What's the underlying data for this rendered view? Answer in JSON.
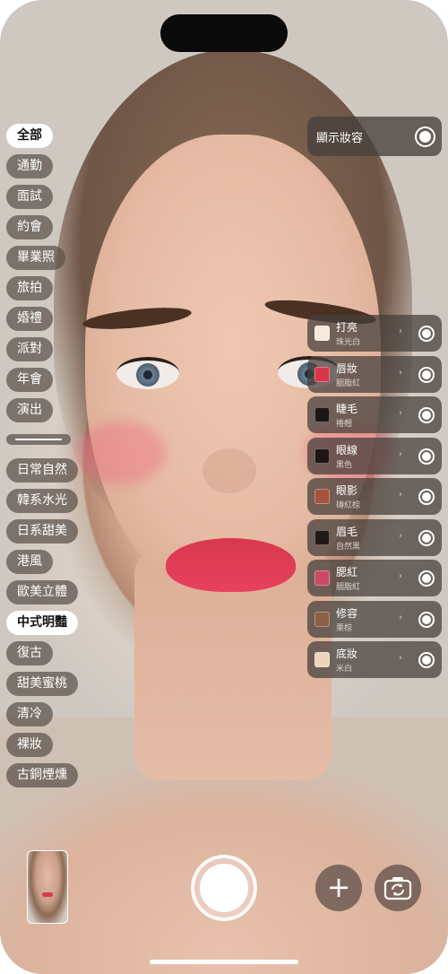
{
  "categories": {
    "occasions": [
      "全部",
      "通勤",
      "面試",
      "約會",
      "畢業照",
      "旅拍",
      "婚禮",
      "派對",
      "年會",
      "演出"
    ],
    "styles": [
      "日常自然",
      "韓系水光",
      "日系甜美",
      "港風",
      "歐美立體",
      "中式明豔",
      "復古",
      "甜美蜜桃",
      "清冷",
      "裸妝",
      "古銅煙燻"
    ],
    "active_occasion": "全部",
    "active_style": "中式明豔"
  },
  "show_makeup": {
    "label": "顯示妝容",
    "enabled": true
  },
  "makeup_items": [
    {
      "title": "打亮",
      "subtitle": "珠光白",
      "color": "#f6eadc",
      "enabled": true
    },
    {
      "title": "唇妝",
      "subtitle": "胭脂紅",
      "color": "#d8344a",
      "enabled": true
    },
    {
      "title": "睫毛",
      "subtitle": "捲翹",
      "color": "#1c1715",
      "enabled": true
    },
    {
      "title": "眼線",
      "subtitle": "黑色",
      "color": "#1d1816",
      "enabled": true
    },
    {
      "title": "眼影",
      "subtitle": "磚紅棕",
      "color": "#a4533c",
      "enabled": true
    },
    {
      "title": "眉毛",
      "subtitle": "自然黑",
      "color": "#201a17",
      "enabled": true
    },
    {
      "title": "腮紅",
      "subtitle": "胭脂紅",
      "color": "#c94b63",
      "enabled": true
    },
    {
      "title": "修容",
      "subtitle": "栗棕",
      "color": "#8a5f45",
      "enabled": true
    },
    {
      "title": "底妝",
      "subtitle": "米白",
      "color": "#ecd4bd",
      "enabled": true
    }
  ],
  "controls": {
    "chevron": "›",
    "add_glyph": "+",
    "icons": [
      "gallery-thumbnail",
      "shutter-button",
      "add-icon",
      "camera-flip-icon"
    ]
  }
}
